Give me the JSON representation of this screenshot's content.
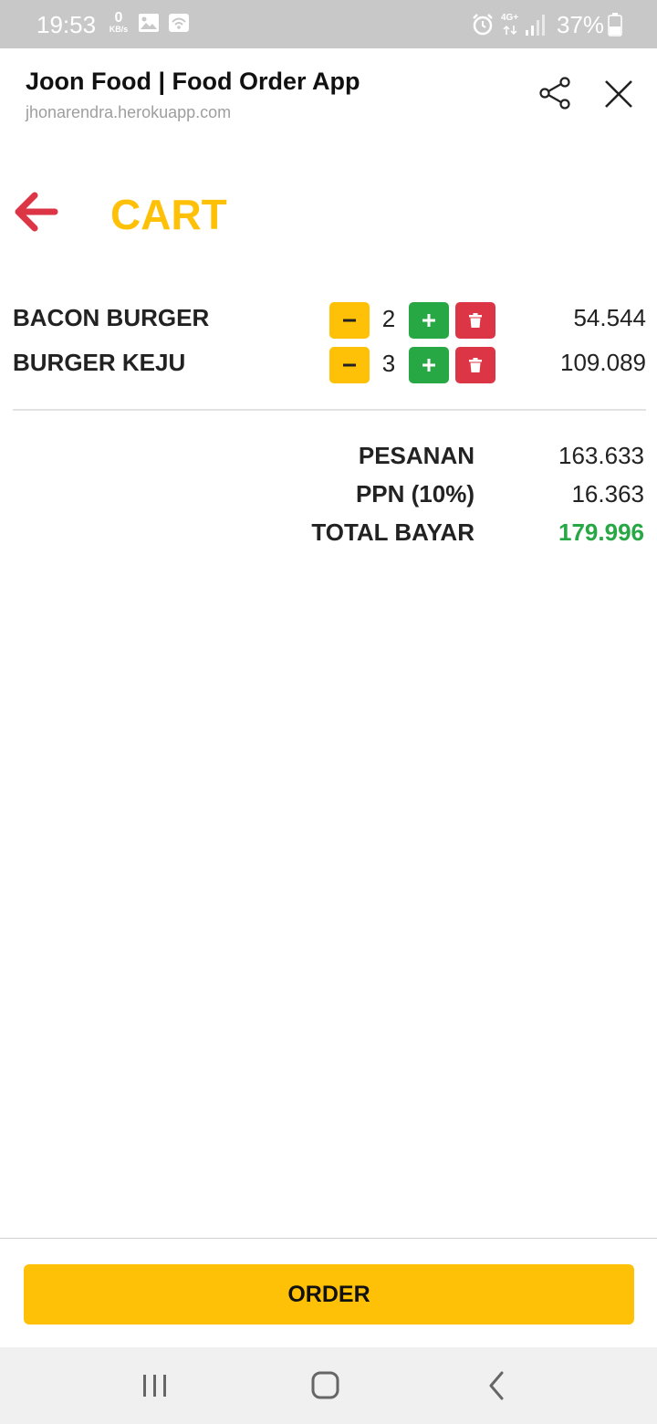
{
  "status_bar": {
    "time": "19:53",
    "data_rate": "0",
    "data_unit": "KB/s",
    "network": "4G+",
    "battery": "37%",
    "icons": [
      "image-icon",
      "wifi-hotspot-icon",
      "alarm-icon",
      "signal-icon",
      "battery-icon"
    ]
  },
  "browser": {
    "title": "Joon Food | Food Order App",
    "url": "jhonarendra.herokuapp.com",
    "icons": [
      "share-icon",
      "close-icon"
    ]
  },
  "cart": {
    "title": "CART",
    "back_icon": "arrow-left-icon",
    "items": [
      {
        "name": "BACON BURGER",
        "qty": "2",
        "price": "54.544"
      },
      {
        "name": "BURGER KEJU",
        "qty": "3",
        "price": "109.089"
      }
    ],
    "buttons": {
      "minus": "−",
      "plus": "+",
      "delete_icon": "trash-icon"
    }
  },
  "summary": {
    "pesanan_label": "PESANAN",
    "pesanan_value": "163.633",
    "ppn_label": "PPN (10%)",
    "ppn_value": "16.363",
    "total_label": "TOTAL BAYAR",
    "total_value": "179.996"
  },
  "order": {
    "label": "ORDER"
  },
  "nav": {
    "icons": [
      "recent-apps-icon",
      "home-icon",
      "back-icon"
    ]
  },
  "colors": {
    "accent_yellow": "#ffc107",
    "plus_green": "#28a745",
    "delete_red": "#dc3545",
    "back_arrow_red": "#dc3545",
    "total_green": "#28a745"
  }
}
